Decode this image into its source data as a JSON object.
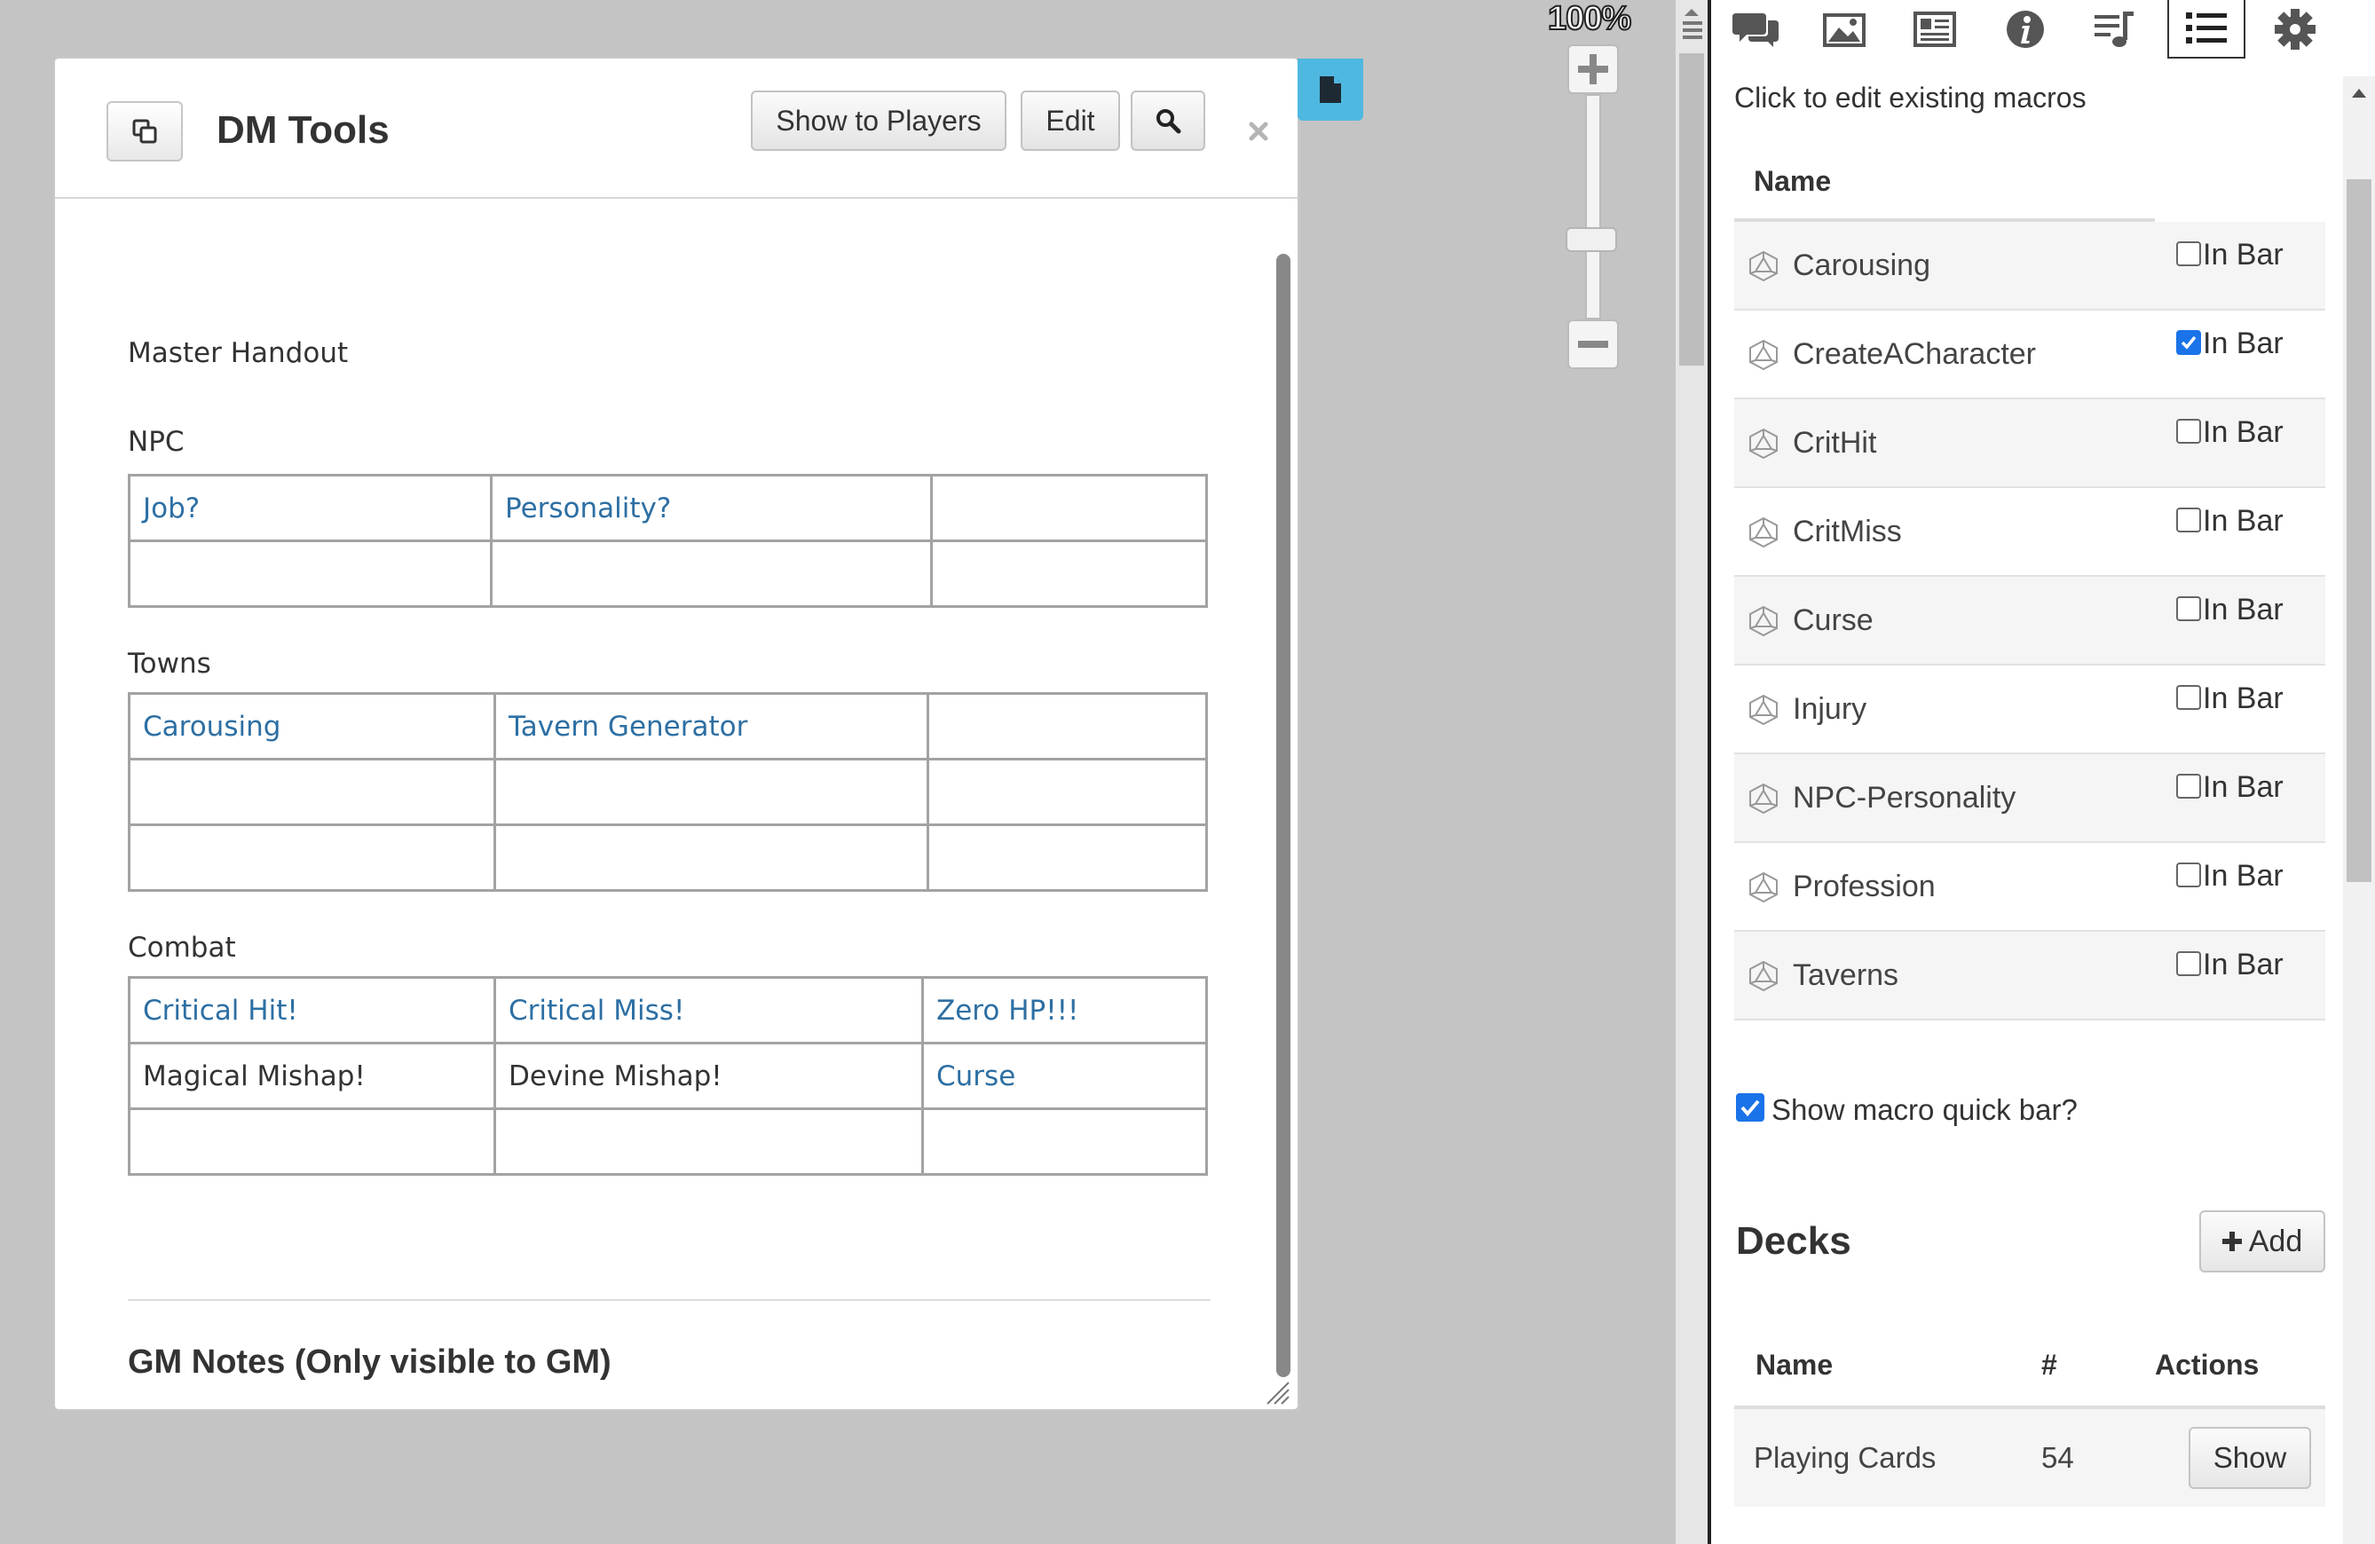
{
  "handout": {
    "title": "DM Tools",
    "buttons": {
      "show_to_players": "Show to Players",
      "edit": "Edit"
    },
    "master_handout": "Master Handout",
    "sections": {
      "npc": {
        "heading": "NPC",
        "rows": [
          [
            "Job?",
            "Personality?",
            ""
          ],
          [
            "",
            "",
            ""
          ]
        ]
      },
      "towns": {
        "heading": "Towns",
        "rows": [
          [
            "Carousing",
            "Tavern Generator",
            ""
          ],
          [
            "",
            "",
            ""
          ],
          [
            "",
            "",
            ""
          ]
        ]
      },
      "combat": {
        "heading": "Combat",
        "rows": [
          [
            "Critical Hit!",
            "Critical Miss!",
            "Zero HP!!!"
          ],
          [
            "Magical Mishap!",
            "Devine Mishap!",
            "Curse"
          ],
          [
            "",
            "",
            ""
          ]
        ]
      }
    },
    "gm_notes": "GM Notes (Only visible to GM)"
  },
  "zoom": {
    "level": "100%"
  },
  "panel": {
    "tabs": [
      {
        "icon": "chat-bubbles-icon"
      },
      {
        "icon": "art-library-icon"
      },
      {
        "icon": "journal-icon"
      },
      {
        "icon": "info-icon"
      },
      {
        "icon": "jukebox-icon"
      },
      {
        "icon": "collections-list-icon",
        "active": true
      },
      {
        "icon": "settings-gear-icon"
      }
    ],
    "hint": "Click to edit existing macros",
    "name_header": "Name",
    "in_bar_label": "In Bar",
    "macros": [
      {
        "name": "Carousing",
        "in_bar": false
      },
      {
        "name": "CreateACharacter",
        "in_bar": true
      },
      {
        "name": "CritHit",
        "in_bar": false
      },
      {
        "name": "CritMiss",
        "in_bar": false
      },
      {
        "name": "Curse",
        "in_bar": false
      },
      {
        "name": "Injury",
        "in_bar": false
      },
      {
        "name": "NPC-Personality",
        "in_bar": false
      },
      {
        "name": "Profession",
        "in_bar": false
      },
      {
        "name": "Taverns",
        "in_bar": false
      }
    ],
    "quick_bar": {
      "label": "Show macro quick bar?",
      "checked": true
    },
    "decks": {
      "title": "Decks",
      "add_label": "Add",
      "headers": {
        "name": "Name",
        "count": "#",
        "actions": "Actions"
      },
      "rows": [
        {
          "name": "Playing Cards",
          "count": "54",
          "action": "Show"
        }
      ]
    }
  },
  "colors": {
    "link": "#2d6fa3",
    "accent_tab": "#4fb8e0",
    "checkbox": "#1a73e8"
  }
}
